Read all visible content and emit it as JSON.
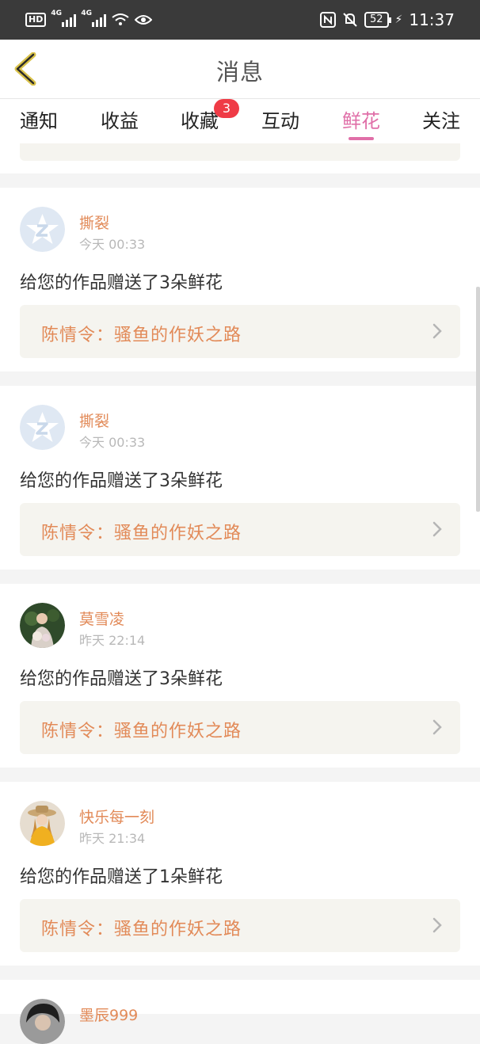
{
  "status_bar": {
    "hd": "HD",
    "sig1": "4G",
    "sig2": "4G",
    "battery": "52",
    "time": "11:37"
  },
  "header": {
    "title": "消息"
  },
  "tabs": [
    {
      "label": "通知"
    },
    {
      "label": "收益"
    },
    {
      "label": "收藏",
      "badge": "3"
    },
    {
      "label": "互动"
    },
    {
      "label": "鲜花",
      "active": true
    },
    {
      "label": "关注"
    }
  ],
  "feed": {
    "items": [
      {
        "name": "撕裂",
        "time": "今天 00:33",
        "message": "给您的作品赠送了3朵鲜花",
        "work": "陈情令：骚鱼的作妖之路",
        "avatar": "default-star-avatar"
      },
      {
        "name": "撕裂",
        "time": "今天 00:33",
        "message": "给您的作品赠送了3朵鲜花",
        "work": "陈情令：骚鱼的作妖之路",
        "avatar": "default-star-avatar"
      },
      {
        "name": "莫雪凌",
        "time": "昨天 22:14",
        "message": "给您的作品赠送了3朵鲜花",
        "work": "陈情令：骚鱼的作妖之路",
        "avatar": "photo-avatar-flowers"
      },
      {
        "name": "快乐每一刻",
        "time": "昨天 21:34",
        "message": "给您的作品赠送了1朵鲜花",
        "work": "陈情令：骚鱼的作妖之路",
        "avatar": "photo-avatar-hat"
      },
      {
        "name": "墨辰999",
        "avatar": "photo-avatar-dark"
      }
    ]
  },
  "colors": {
    "accent": "#e06fa8",
    "name": "#e28a58",
    "badge": "#ef3b46",
    "work_bg": "#f5f4ef"
  }
}
